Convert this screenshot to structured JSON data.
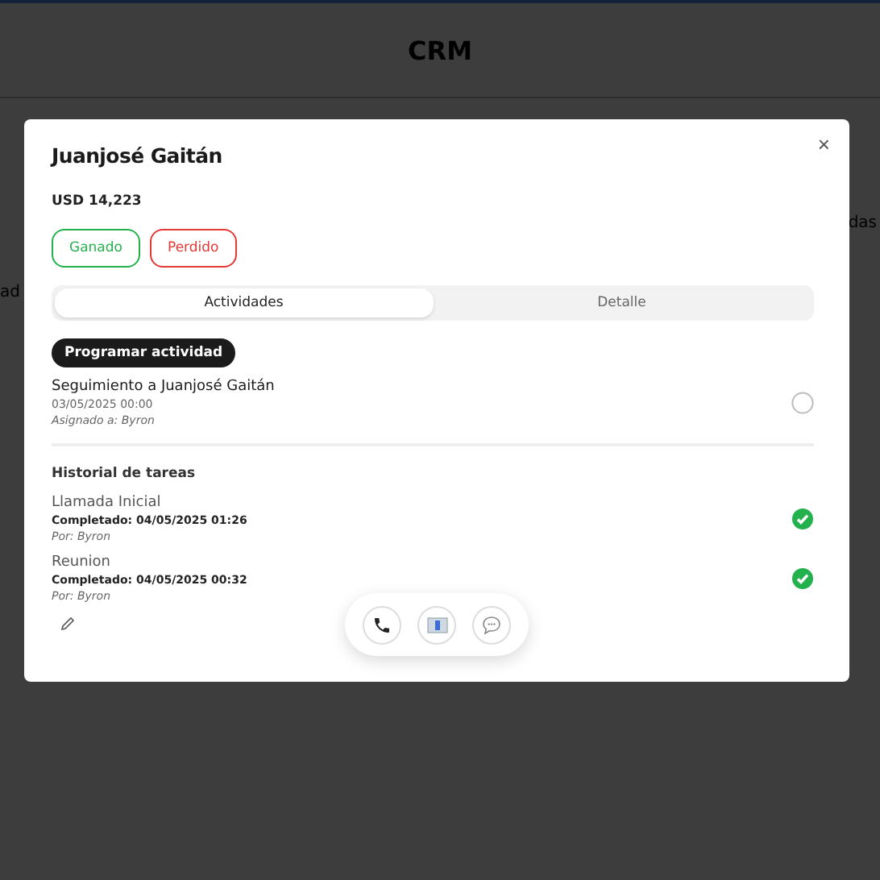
{
  "page": {
    "title": "CRM",
    "left_fragment": "ad",
    "right_fragment": "das"
  },
  "modal": {
    "title": "Juanjosé Gaitán",
    "amount": "USD 14,223",
    "close": "×",
    "status_buttons": [
      {
        "label": "Ganado",
        "kind": "won"
      },
      {
        "label": "Perdido",
        "kind": "lost"
      }
    ],
    "tabs": [
      {
        "label": "Actividades",
        "selected": true
      },
      {
        "label": "Detalle",
        "selected": false
      }
    ],
    "schedule_button": "Programar actividad",
    "scheduled": [
      {
        "title": "Seguimiento a Juanjosé Gaitán",
        "date": "03/05/2025 00:00",
        "assignee": "Asignado a: Byron",
        "done": false
      }
    ],
    "history_title": "Historial de tareas",
    "history": [
      {
        "title": "Llamada Inicial",
        "date": "Completado: 04/05/2025 01:26",
        "by": "Por: Byron",
        "done": true
      },
      {
        "title": "Reunion",
        "date": "Completado: 04/05/2025 00:32",
        "by": "Por: Byron",
        "done": true
      }
    ],
    "actions": [
      {
        "kind": "phone"
      },
      {
        "kind": "email"
      },
      {
        "kind": "chat"
      }
    ]
  }
}
